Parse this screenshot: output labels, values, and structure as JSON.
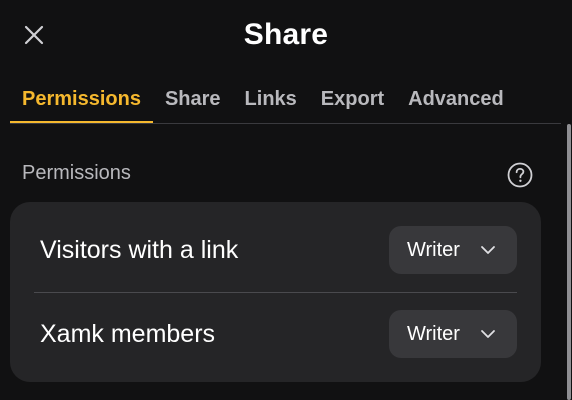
{
  "dialog": {
    "title": "Share",
    "close_icon": "close-icon"
  },
  "tabs": [
    {
      "label": "Permissions",
      "active": true
    },
    {
      "label": "Share",
      "active": false
    },
    {
      "label": "Links",
      "active": false
    },
    {
      "label": "Export",
      "active": false
    },
    {
      "label": "Advanced",
      "active": false
    }
  ],
  "permissions": {
    "heading": "Permissions",
    "help_icon": "help-circle-icon",
    "rows": [
      {
        "label": "Visitors with a link",
        "role": "Writer"
      },
      {
        "label": "Xamk members",
        "role": "Writer"
      }
    ]
  },
  "colors": {
    "background": "#111112",
    "accent": "#f5b82e",
    "card": "#252527",
    "select": "#38383b"
  }
}
